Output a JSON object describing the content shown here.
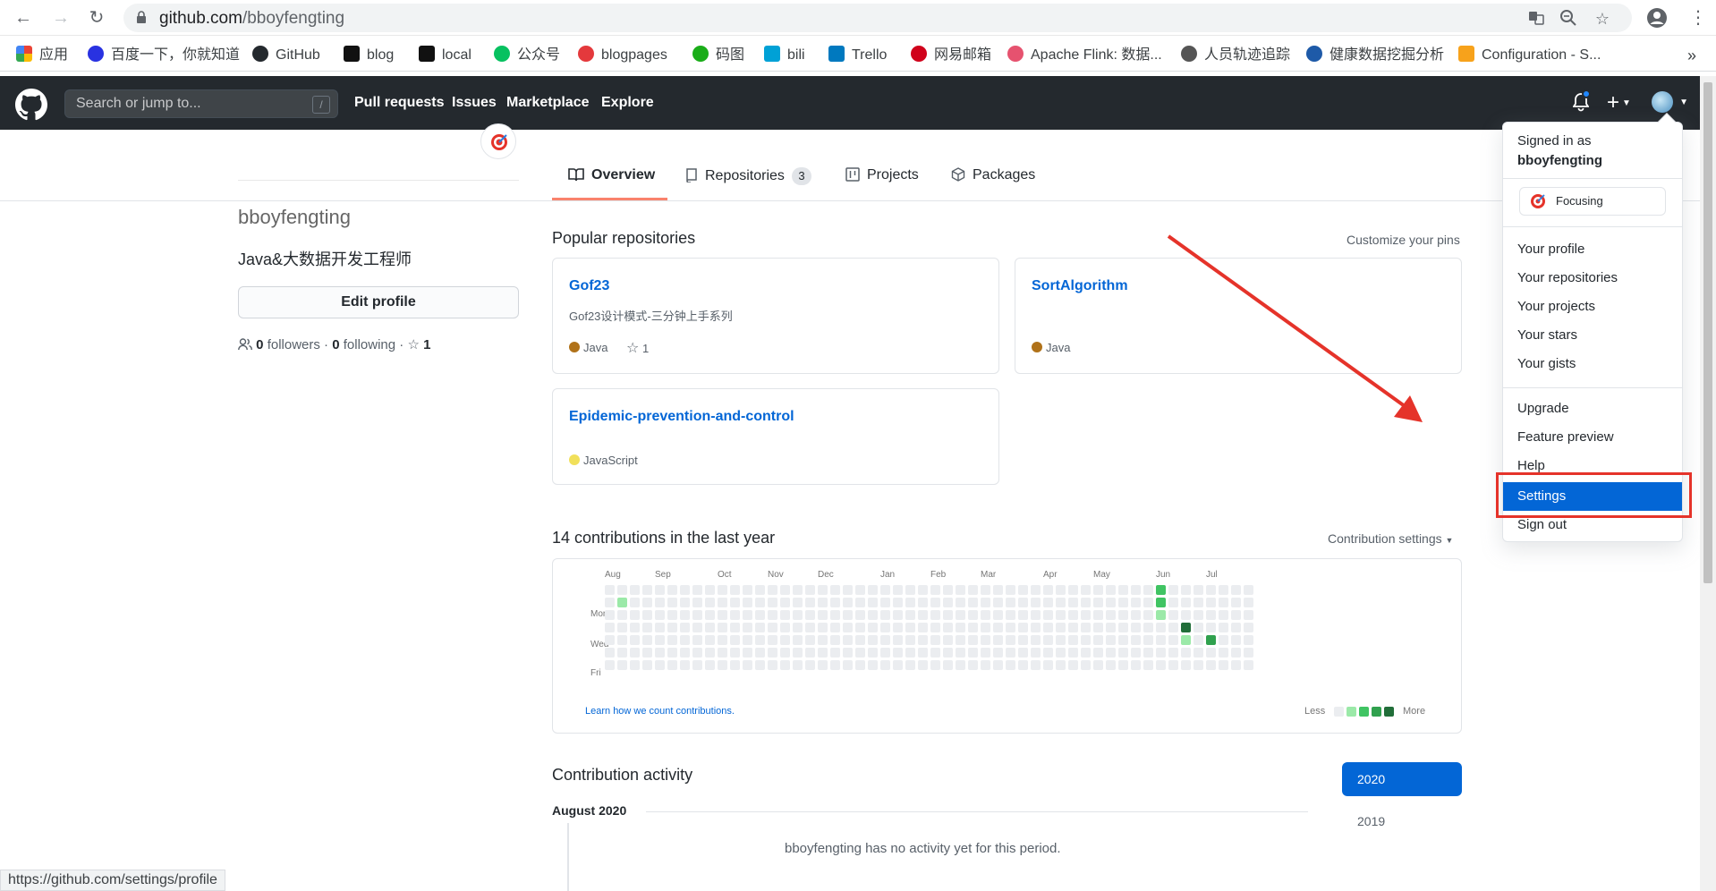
{
  "browser": {
    "url_host": "github.com",
    "url_path": "/bboyfengting",
    "status_url": "https://github.com/settings/profile",
    "bookmarks": [
      {
        "label": "应用",
        "color": "#ea4335"
      },
      {
        "label": "百度一下，你就知道",
        "color": "#2932e1"
      },
      {
        "label": "GitHub",
        "color": "#24292e"
      },
      {
        "label": "blog",
        "color": "#111111"
      },
      {
        "label": "local",
        "color": "#111111"
      },
      {
        "label": "公众号",
        "color": "#07c160"
      },
      {
        "label": "blogpages",
        "color": "#e4393c"
      },
      {
        "label": "码图",
        "color": "#1aad19"
      },
      {
        "label": "bili",
        "color": "#00a1d6"
      },
      {
        "label": "Trello",
        "color": "#0079bf"
      },
      {
        "label": "网易邮箱",
        "color": "#d0021b"
      },
      {
        "label": "Apache Flink: 数据...",
        "color": "#e6526f"
      },
      {
        "label": "人员轨迹追踪",
        "color": "#555555"
      },
      {
        "label": "健康数据挖掘分析",
        "color": "#1e5aa8"
      },
      {
        "label": "Configuration - S...",
        "color": "#f7a21b"
      }
    ],
    "more": "»"
  },
  "gh_header": {
    "search_placeholder": "Search or jump to...",
    "search_shortcut": "/",
    "nav": [
      "Pull requests",
      "Issues",
      "Marketplace",
      "Explore"
    ]
  },
  "tabs": [
    {
      "label": "Overview"
    },
    {
      "label": "Repositories",
      "count": "3"
    },
    {
      "label": "Projects"
    },
    {
      "label": "Packages"
    }
  ],
  "profile": {
    "username": "bboyfengting",
    "bio": "Java&大数据开发工程师",
    "edit_label": "Edit profile",
    "followers_count": "0",
    "followers_label": "followers",
    "separator": "·",
    "following_count": "0",
    "following_label": "following",
    "stars_count": "1"
  },
  "popular": {
    "title": "Popular repositories",
    "customize": "Customize your pins",
    "repos": [
      {
        "name": "Gof23",
        "desc": "Gof23设计模式-三分钟上手系列",
        "lang": "Java",
        "lang_color": "#b07219",
        "stars": "1"
      },
      {
        "name": "SortAlgorithm",
        "desc": "",
        "lang": "Java",
        "lang_color": "#b07219",
        "stars": ""
      },
      {
        "name": "Epidemic-prevention-and-control",
        "desc": "",
        "lang": "JavaScript",
        "lang_color": "#f1e05a",
        "stars": ""
      }
    ]
  },
  "contrib": {
    "title": "14 contributions in the last year",
    "settings_label": "Contribution settings",
    "months": [
      "Aug",
      "Sep",
      "Oct",
      "Nov",
      "Dec",
      "Jan",
      "Feb",
      "Mar",
      "Apr",
      "May",
      "Jun",
      "Jul"
    ],
    "days": [
      "Mon",
      "Wed",
      "Fri"
    ],
    "learn": "Learn how we count contributions.",
    "less": "Less",
    "more": "More",
    "levels": [
      "#ebedf0",
      "#9be9a8",
      "#40c463",
      "#30a14e",
      "#216e39"
    ],
    "cells": [
      {
        "week": 1,
        "day": 1,
        "level": 1
      },
      {
        "week": 44,
        "day": 0,
        "level": 2
      },
      {
        "week": 44,
        "day": 1,
        "level": 2
      },
      {
        "week": 44,
        "day": 2,
        "level": 1
      },
      {
        "week": 46,
        "day": 3,
        "level": 4
      },
      {
        "week": 46,
        "day": 4,
        "level": 1
      },
      {
        "week": 48,
        "day": 4,
        "level": 3
      }
    ]
  },
  "activity": {
    "title": "Contribution activity",
    "month": "August 2020",
    "empty": "bboyfengting has no activity yet for this period.",
    "years": [
      "2020",
      "2019"
    ]
  },
  "dropdown": {
    "signed_in_as": "Signed in as",
    "user": "bboyfengting",
    "status": "Focusing",
    "group1": [
      "Your profile",
      "Your repositories",
      "Your projects",
      "Your stars",
      "Your gists"
    ],
    "group2": [
      "Upgrade",
      "Feature preview",
      "Help"
    ],
    "settings": "Settings",
    "sign_out": "Sign out"
  },
  "colors": {
    "header_bg": "#24292e",
    "link": "#0366d6",
    "accent_underline": "#f9826c",
    "annotation_red": "#e5332a",
    "notification_dot": "#2188ff"
  }
}
